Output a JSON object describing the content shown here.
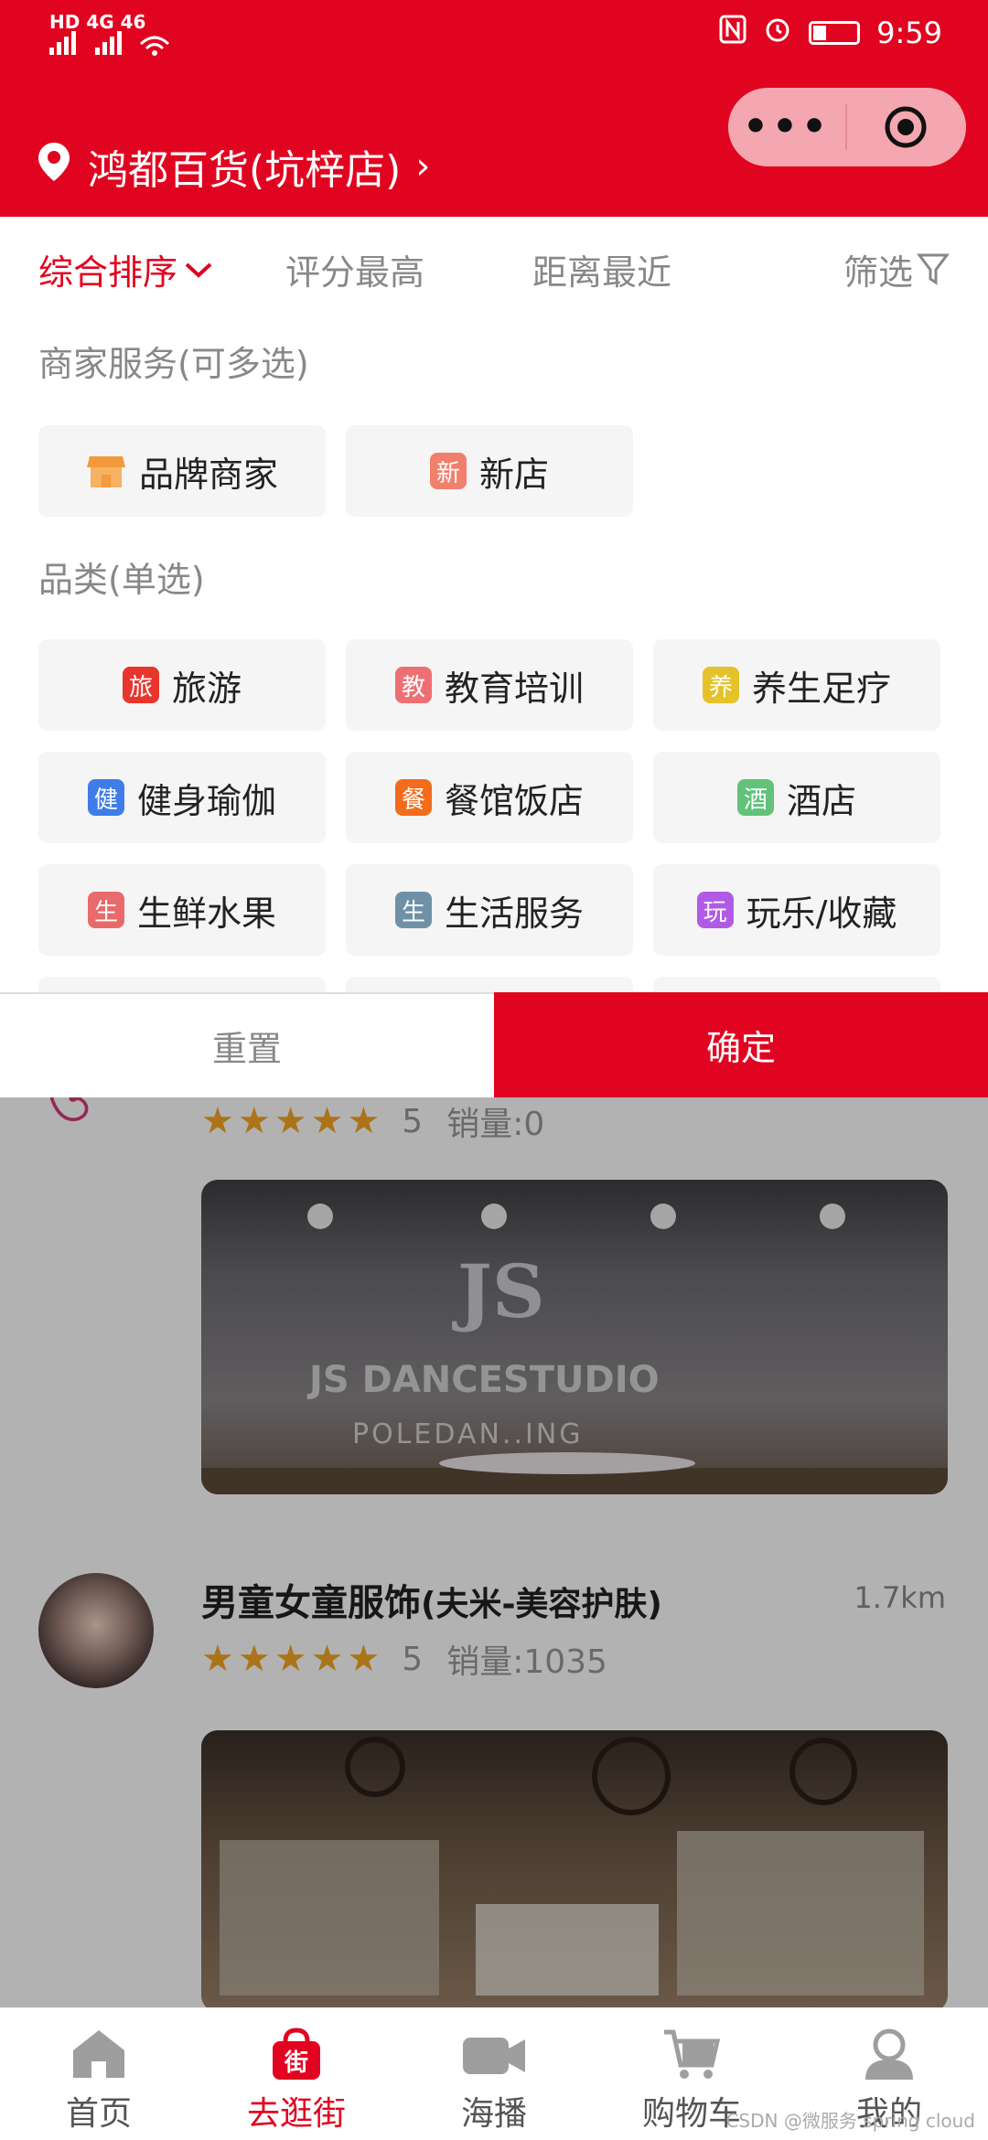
{
  "status_bar": {
    "left_text": "HD 4G 46",
    "time": "9:59"
  },
  "header": {
    "location_name": "鸿都百货(坑梓店)"
  },
  "sort_tabs": [
    {
      "label": "综合排序",
      "active": true
    },
    {
      "label": "评分最高",
      "active": false
    },
    {
      "label": "距离最近",
      "active": false
    },
    {
      "label": "筛选",
      "active": false
    }
  ],
  "merchant_services": {
    "title": "商家服务(可多选)",
    "options": [
      {
        "label": "品牌商家",
        "icon": "shop-icon",
        "color": "#f39a3c"
      },
      {
        "label": "新店",
        "tag": "新",
        "color": "#f07f6c"
      }
    ]
  },
  "categories": {
    "title": "品类(单选)",
    "options": [
      {
        "label": "旅游",
        "tag": "旅",
        "color": "#e8352d"
      },
      {
        "label": "教育培训",
        "tag": "教",
        "color": "#ee6f73"
      },
      {
        "label": "养生足疗",
        "tag": "养",
        "color": "#e6c22a"
      },
      {
        "label": "健身瑜伽",
        "tag": "健",
        "color": "#3e7de8"
      },
      {
        "label": "餐馆饭店",
        "tag": "餐",
        "color": "#f36b1c"
      },
      {
        "label": "酒店",
        "tag": "酒",
        "color": "#63c27a"
      },
      {
        "label": "生鲜水果",
        "tag": "生",
        "color": "#e86a6a"
      },
      {
        "label": "生活服务",
        "tag": "生",
        "color": "#6f91a8"
      },
      {
        "label": "玩乐/收藏",
        "tag": "玩",
        "color": "#b15ae6"
      }
    ]
  },
  "buttons": {
    "reset": "重置",
    "confirm": "确定"
  },
  "stores": [
    {
      "rating_score": "5",
      "sales": "销量:0",
      "photo_text_1": "JS",
      "photo_text_2": "JS DANCESTUDIO",
      "photo_text_3": "POLEDAN..ING"
    },
    {
      "name": "男童女童服饰",
      "subname": "(夫米-美容护肤)",
      "distance": "1.7km",
      "rating_score": "5",
      "sales": "销量:1035"
    }
  ],
  "tabbar": [
    {
      "label": "首页",
      "icon": "home-icon",
      "active": false
    },
    {
      "label": "去逛街",
      "icon": "street-bag-icon",
      "active": true
    },
    {
      "label": "海播",
      "icon": "video-camera-icon",
      "active": false
    },
    {
      "label": "购物车",
      "icon": "cart-icon",
      "active": false
    },
    {
      "label": "我的",
      "icon": "user-icon",
      "active": false
    }
  ],
  "watermark": "CSDN @微服务 spring cloud",
  "colors": {
    "brand_red": "#e10420",
    "star": "#f5a623"
  }
}
